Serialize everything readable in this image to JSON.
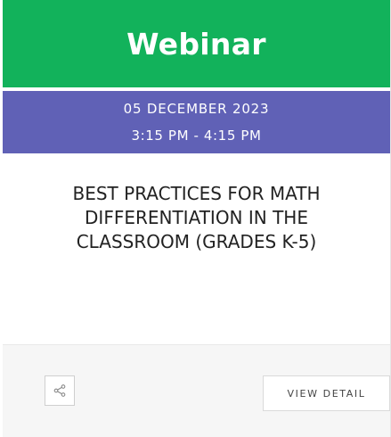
{
  "header": {
    "title": "Webinar",
    "color": "#12b25b"
  },
  "schedule": {
    "date": "05 DECEMBER 2023",
    "time": "3:15 PM - 4:15 PM",
    "color": "#6061b6"
  },
  "event": {
    "title": "BEST PRACTICES FOR MATH DIFFERENTIATION IN THE CLASSROOM (GRADES K-5)"
  },
  "footer": {
    "share_icon": "share-icon",
    "detail_label": "VIEW DETAIL"
  }
}
